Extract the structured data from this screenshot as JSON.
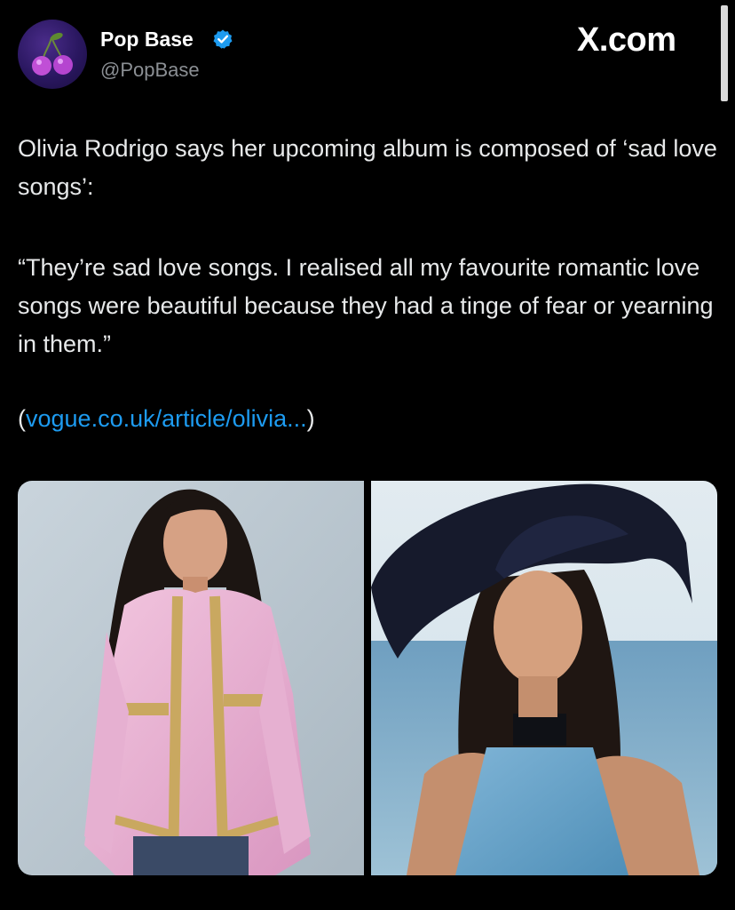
{
  "header": {
    "display_name": "Pop Base",
    "handle": "@PopBase",
    "verified": true,
    "avatar_icon": "cherries-icon",
    "site_mark": "X.com"
  },
  "tweet": {
    "line_1": "Olivia Rodrigo says her upcoming album is composed of ‘sad love songs’:",
    "quote": "“They’re sad love songs. I realised all my favourite romantic love songs were beautiful because they had a tinge of fear or yearning in them.”",
    "link_open": "(",
    "link_text": "vogue.co.uk/article/olivia...",
    "link_close": ")"
  },
  "media": [
    {
      "name": "photo-pink-jacket"
    },
    {
      "name": "photo-black-hat-ocean"
    }
  ],
  "colors": {
    "background": "#000000",
    "text": "#e7e9ea",
    "secondary_text": "#8b8f94",
    "link": "#1d9bf0",
    "verified_badge": "#1d9bf0"
  }
}
